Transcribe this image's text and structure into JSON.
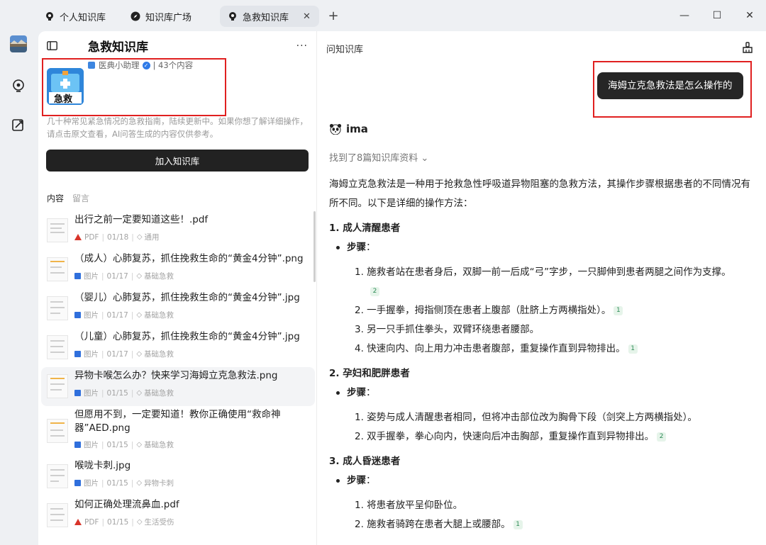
{
  "tabs": [
    {
      "label": "个人知识库",
      "icon": "bulb-icon",
      "active": false
    },
    {
      "label": "知识库广场",
      "icon": "compass-icon",
      "active": false
    },
    {
      "label": "急救知识库",
      "icon": "bulb-icon",
      "active": true,
      "close": "✕"
    }
  ],
  "new_tab": "+",
  "window_controls": {
    "min": "—",
    "max": "☐",
    "close": "✕"
  },
  "kb": {
    "cover_label": "急救",
    "title": "急救知识库",
    "author": "医典小助理",
    "count": "| 43个内容",
    "description": "几十种常见紧急情况的急救指南，陆续更新中。如果你想了解详细操作，请点击原文查看，AI问答生成的内容仅供参考。",
    "join_label": "加入知识库",
    "more": "···"
  },
  "content_tabs": {
    "content": "内容",
    "comments": "留言"
  },
  "docs": [
    {
      "title": "出行之前一定要知道这些！.pdf",
      "type": "PDF",
      "date": "01/18",
      "tag": "通用"
    },
    {
      "title": "（成人）心肺复苏，抓住挽救生命的“黄金4分钟”.png",
      "type": "图片",
      "date": "01/17",
      "tag": "基础急救"
    },
    {
      "title": "（婴儿）心肺复苏，抓住挽救生命的“黄金4分钟”.jpg",
      "type": "图片",
      "date": "01/17",
      "tag": "基础急救"
    },
    {
      "title": "（儿童）心肺复苏，抓住挽救生命的“黄金4分钟”.jpg",
      "type": "图片",
      "date": "01/17",
      "tag": "基础急救"
    },
    {
      "title": "异物卡喉怎么办？快来学习海姆立克急救法.png",
      "type": "图片",
      "date": "01/15",
      "tag": "基础急救"
    },
    {
      "title": "但愿用不到，一定要知道！教你正确使用“救命神器”AED.png",
      "type": "图片",
      "date": "01/15",
      "tag": "基础急救"
    },
    {
      "title": "喉咙卡刺.jpg",
      "type": "图片",
      "date": "01/15",
      "tag": "异物卡刺"
    },
    {
      "title": "如何正确处理流鼻血.pdf",
      "type": "PDF",
      "date": "01/15",
      "tag": "生活受伤"
    }
  ],
  "chat": {
    "title": "问知识库",
    "question": "海姆立克急救法是怎么操作的",
    "bot_name": "ima",
    "found": "找到了8篇知识库资料 ⌄",
    "intro": "海姆立克急救法是一种用于抢救急性呼吸道异物阻塞的急救方法，其操作步骤根据患者的不同情况有所不同。以下是详细的操作方法：",
    "sections": [
      {
        "heading": "1. 成人清醒患者",
        "bullet": "步骤",
        "steps": [
          {
            "text": "1. 施救者站在患者身后，双脚一前一后成“弓”字步，一只脚伸到患者两腿之间作为支撑。",
            "cite": "2"
          },
          {
            "text": "2. 一手握拳，拇指侧顶在患者上腹部（肚脐上方两横指处）。",
            "cite": "1"
          },
          {
            "text": "3. 另一只手抓住拳头，双臂环绕患者腰部。",
            "cite": ""
          },
          {
            "text": "4. 快速向内、向上用力冲击患者腹部，重复操作直到异物排出。",
            "cite": "1"
          }
        ]
      },
      {
        "heading": "2. 孕妇和肥胖患者",
        "bullet": "步骤",
        "steps": [
          {
            "text": "1. 姿势与成人清醒患者相同，但将冲击部位改为胸骨下段（剑突上方两横指处）。",
            "cite": ""
          },
          {
            "text": "2. 双手握拳，拳心向内，快速向后冲击胸部，重复操作直到异物排出。",
            "cite": "2"
          }
        ]
      },
      {
        "heading": "3. 成人昏迷患者",
        "bullet": "步骤",
        "steps": [
          {
            "text": "1. 将患者放平呈仰卧位。",
            "cite": ""
          },
          {
            "text": "2. 施救者骑跨在患者大腿上或腰部。",
            "cite": "1"
          }
        ]
      }
    ]
  },
  "colors": {
    "accent_dark": "#262626",
    "highlight": "#e02020",
    "pdf": "#d8342a",
    "image": "#2f6fdc",
    "cite_bg": "#e6f4ea"
  }
}
